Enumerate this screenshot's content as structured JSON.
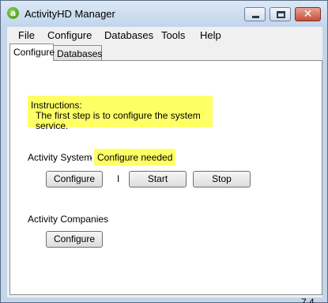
{
  "window": {
    "title": "ActivityHD Manager",
    "app_icon_glyph": "a",
    "close_glyph": "✕"
  },
  "menu": [
    "File",
    "Configure",
    "Databases",
    "Tools",
    "Help"
  ],
  "tabs": [
    "Configure",
    "Databases"
  ],
  "instructions": {
    "line1": "Instructions:",
    "line2": "The first step is to configure the system service."
  },
  "activity_system": {
    "label": "Activity System",
    "dash": "-",
    "status": "Configure needed",
    "configure_label": "Configure",
    "separator": "I",
    "start_label": "Start",
    "stop_label": "Stop"
  },
  "activity_companies": {
    "label": "Activity Companies",
    "configure_label": "Configure"
  },
  "version": "7.4",
  "colors": {
    "highlight": "#ffff66",
    "titlebar": "#c4d7ec",
    "close_button": "#c6503a"
  },
  "icons": [
    "app-logo-icon",
    "minimize-icon",
    "maximize-icon",
    "close-icon"
  ]
}
